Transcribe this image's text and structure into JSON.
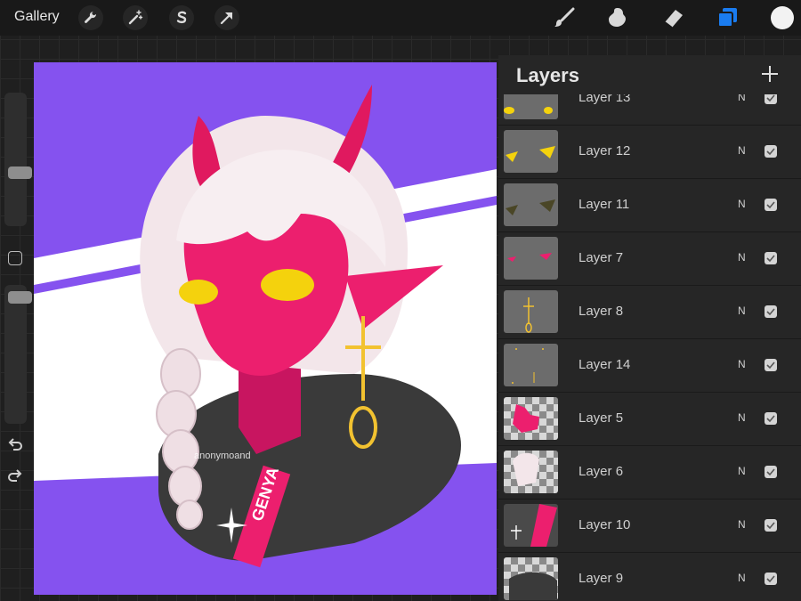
{
  "toolbar": {
    "gallery_label": "Gallery",
    "left_icons": [
      "wrench-icon",
      "magic-wand-icon",
      "selection-s-icon",
      "transform-arrow-icon"
    ],
    "right_icons": [
      "brush-icon",
      "smudge-icon",
      "eraser-icon",
      "layers-icon"
    ],
    "current_color": "#f2f2f2",
    "accent": "#1a7cf0"
  },
  "sidebar": {
    "brush_size_level": 0.5,
    "opacity_level": 0.05,
    "icons": [
      "modify-square-icon",
      "undo-icon",
      "redo-icon"
    ]
  },
  "canvas": {
    "watermark": "anonymoand",
    "hoodie_text": "GENYA",
    "colors": {
      "background": "#8552ef",
      "stripe": "#ffffff",
      "skin": "#ec1f6e",
      "hair": "#f3e6ea",
      "eyes": "#f4d20d",
      "hoodie": "#3a3a3a"
    }
  },
  "layers_panel": {
    "title": "Layers",
    "add_icon": "plus-icon",
    "layers": [
      {
        "name": "Layer 13",
        "blend": "N",
        "visible": true
      },
      {
        "name": "Layer 12",
        "blend": "N",
        "visible": true
      },
      {
        "name": "Layer 11",
        "blend": "N",
        "visible": true
      },
      {
        "name": "Layer 7",
        "blend": "N",
        "visible": true
      },
      {
        "name": "Layer 8",
        "blend": "N",
        "visible": true
      },
      {
        "name": "Layer 14",
        "blend": "N",
        "visible": true
      },
      {
        "name": "Layer 5",
        "blend": "N",
        "visible": true
      },
      {
        "name": "Layer 6",
        "blend": "N",
        "visible": true
      },
      {
        "name": "Layer 10",
        "blend": "N",
        "visible": true
      },
      {
        "name": "Layer 9",
        "blend": "N",
        "visible": true
      }
    ]
  }
}
